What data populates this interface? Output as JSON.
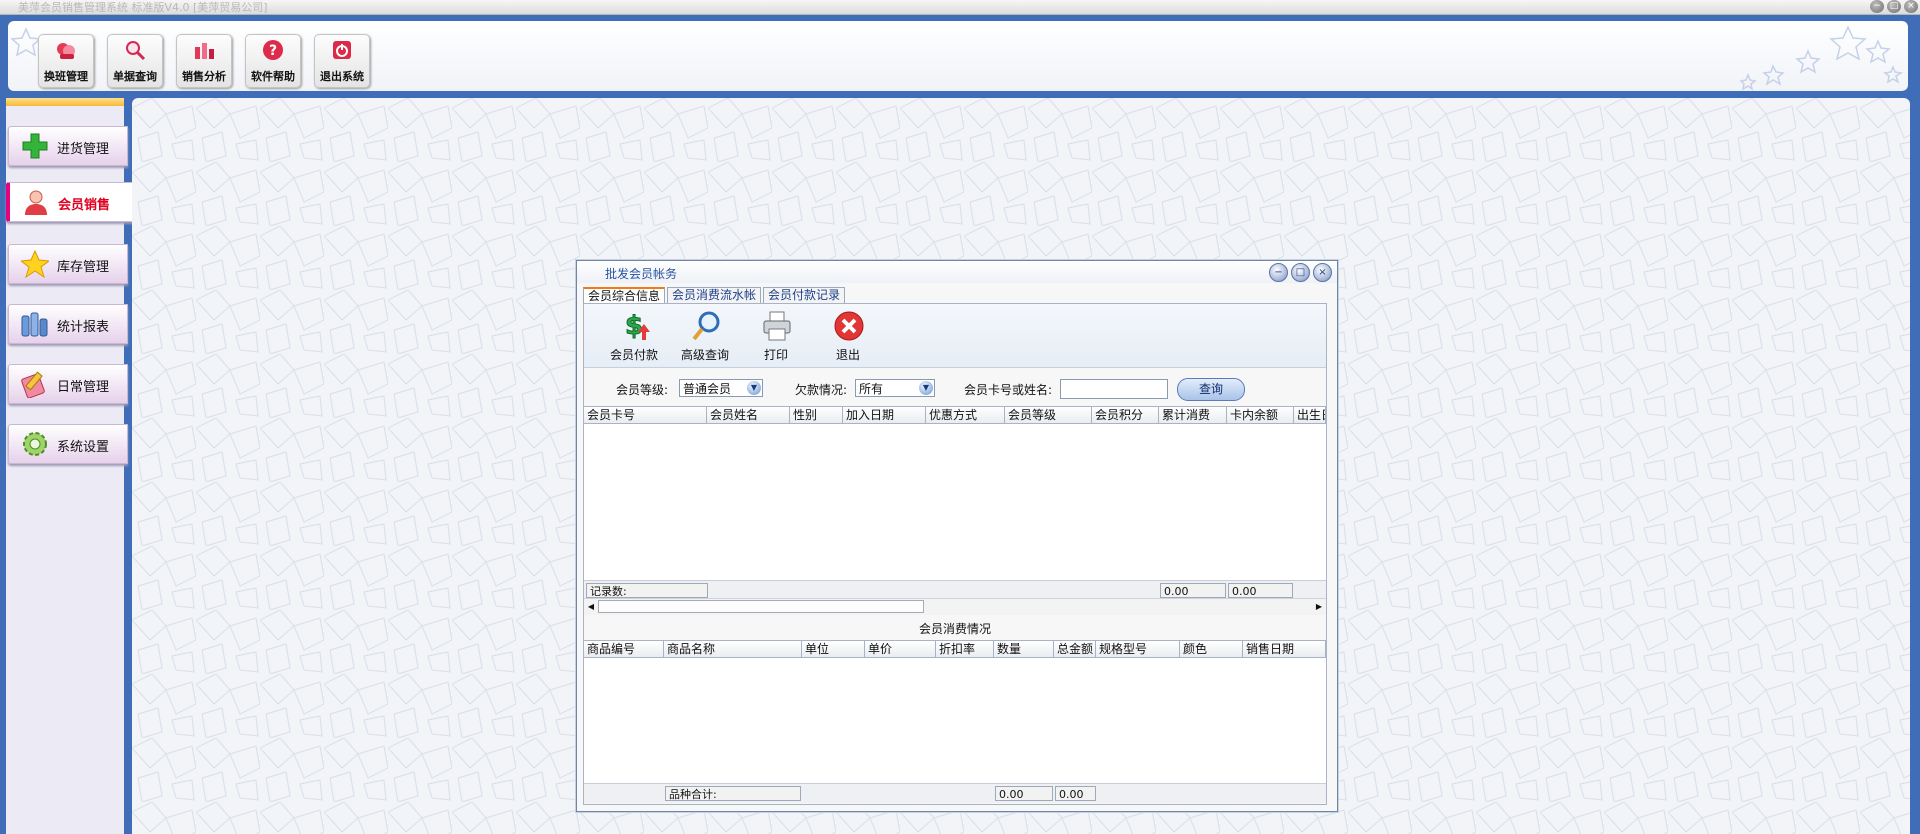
{
  "window": {
    "title": "美萍会员销售管理系统 标准版V4.0 [美萍贸易公司]",
    "controls": [
      "−",
      "□",
      "×"
    ]
  },
  "toolbar": {
    "buttons": [
      {
        "label": "换班管理",
        "icon": "shift-icon"
      },
      {
        "label": "单据查询",
        "icon": "magnifier-icon"
      },
      {
        "label": "销售分析",
        "icon": "bar-chart-icon"
      },
      {
        "label": "软件帮助",
        "icon": "help-icon"
      },
      {
        "label": "退出系统",
        "icon": "power-icon"
      }
    ]
  },
  "sidebar": {
    "items": [
      {
        "label": "进货管理",
        "icon": "plus-icon"
      },
      {
        "label": "会员销售",
        "icon": "member-icon",
        "active": true
      },
      {
        "label": "库存管理",
        "icon": "star-icon"
      },
      {
        "label": "统计报表",
        "icon": "report-icon"
      },
      {
        "label": "日常管理",
        "icon": "notebook-icon"
      },
      {
        "label": "系统设置",
        "icon": "gear-icon"
      }
    ]
  },
  "dialog": {
    "title": "批发会员帐务",
    "tabs": [
      "会员综合信息",
      "会员消费流水帐",
      "会员付款记录"
    ],
    "actions": [
      {
        "label": "会员付款",
        "icon": "payment-icon"
      },
      {
        "label": "高级查询",
        "icon": "search-icon"
      },
      {
        "label": "打印",
        "icon": "printer-icon"
      },
      {
        "label": "退出",
        "icon": "exit-icon"
      }
    ],
    "filters": {
      "level_label": "会员等级:",
      "level_value": "普通会员",
      "debt_label": "欠款情况:",
      "debt_value": "所有",
      "card_label": "会员卡号或姓名:",
      "card_value": "",
      "query_label": "查询"
    },
    "members_table": {
      "columns": [
        "会员卡号",
        "会员姓名",
        "性别",
        "加入日期",
        "优惠方式",
        "会员等级",
        "会员积分",
        "累计消费",
        "卡内余额",
        "出生日"
      ],
      "rows": [],
      "footer": {
        "count_label": "记录数:",
        "total_consumed": "0.00",
        "total_balance": "0.00"
      }
    },
    "consumption": {
      "title": "会员消费情况",
      "columns": [
        "商品编号",
        "商品名称",
        "单位",
        "单价",
        "折扣率",
        "数量",
        "总金额",
        "规格型号",
        "颜色",
        "销售日期"
      ],
      "rows": [],
      "footer": {
        "kinds_label": "品种合计:",
        "total_qty": "0.00",
        "total_amount": "0.00"
      }
    }
  },
  "colors": {
    "frame_blue": "#3f6db7",
    "active_nav_text": "#e00020",
    "active_nav_bar": "#e4007f",
    "tab_accent": "#f07b1c"
  }
}
